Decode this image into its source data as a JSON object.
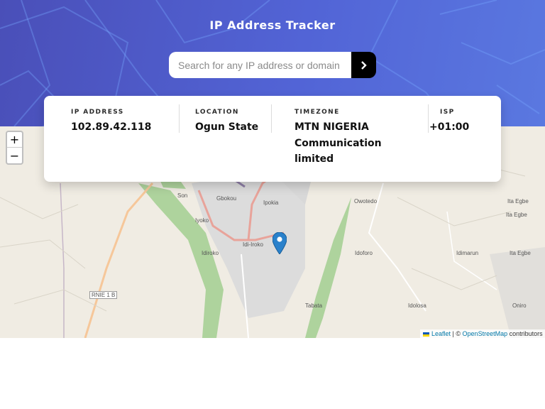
{
  "header": {
    "title": "IP Address Tracker",
    "background_colors": [
      "#4a4fb8",
      "#5a78e0"
    ]
  },
  "search": {
    "placeholder": "Search for any IP address or domain",
    "value": "",
    "submit_icon": "chevron-right-icon"
  },
  "info": {
    "ip": {
      "label": "IP ADDRESS",
      "value": "102.89.42.118"
    },
    "location": {
      "label": "LOCATION",
      "value": "Ogun State"
    },
    "timezone": {
      "label": "TIMEZONE",
      "value": "MTN NIGERIA Communication limited"
    },
    "isp": {
      "label": "ISP",
      "value": "+01:00"
    }
  },
  "map": {
    "zoom_in": "+",
    "zoom_out": "−",
    "marker_icon": "map-marker-icon",
    "places": {
      "son": "Son",
      "gbokou": "Gbokou",
      "ipokia": "Ipokia",
      "owotedo": "Owotedo",
      "ita_egbe_1": "Ita Egbe",
      "ita_egbe_2": "Ita Egbe",
      "ita_egbe_3": "Ita Egbe",
      "iyoko": "Iyoko",
      "idi_iroko": "Idi-Iroko",
      "idiroko": "Idiroko",
      "idoforo": "Idoforo",
      "idimarun": "Idimarun",
      "rnie": "RNIE 1 B",
      "tabata": "Tabata",
      "idolosa": "Idolosa",
      "oniro": "Oniro"
    },
    "attribution": {
      "leaflet": "Leaflet",
      "separator": "| ©",
      "osm": "OpenStreetMap",
      "suffix": "contributors"
    }
  }
}
